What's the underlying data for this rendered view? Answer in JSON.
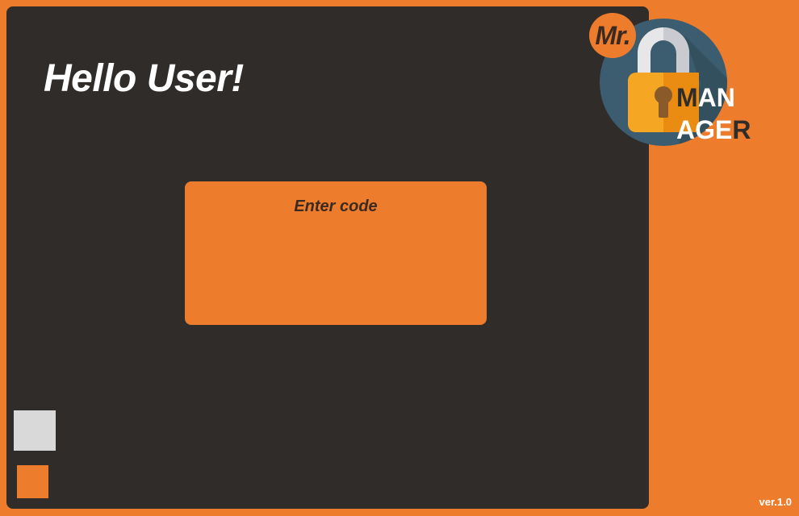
{
  "app": {
    "greeting": "Hello User!",
    "version": "ver.1.0"
  },
  "code_box": {
    "label": "Enter code",
    "value": ""
  },
  "logo": {
    "mr": "Mr.",
    "line1_dark": "M",
    "line1_light": "AN",
    "line2_light": "AGE",
    "line2_dark": "R",
    "icon": "padlock-icon"
  },
  "side_buttons": [
    {
      "name": "gray-square-button",
      "color": "#d9d9d9"
    },
    {
      "name": "orange-square-button",
      "color": "#ed7d2d"
    }
  ],
  "colors": {
    "accent": "#ed7d2d",
    "panel": "#302c2a",
    "text_light": "#ffffff",
    "text_dark": "#3b2a20"
  }
}
